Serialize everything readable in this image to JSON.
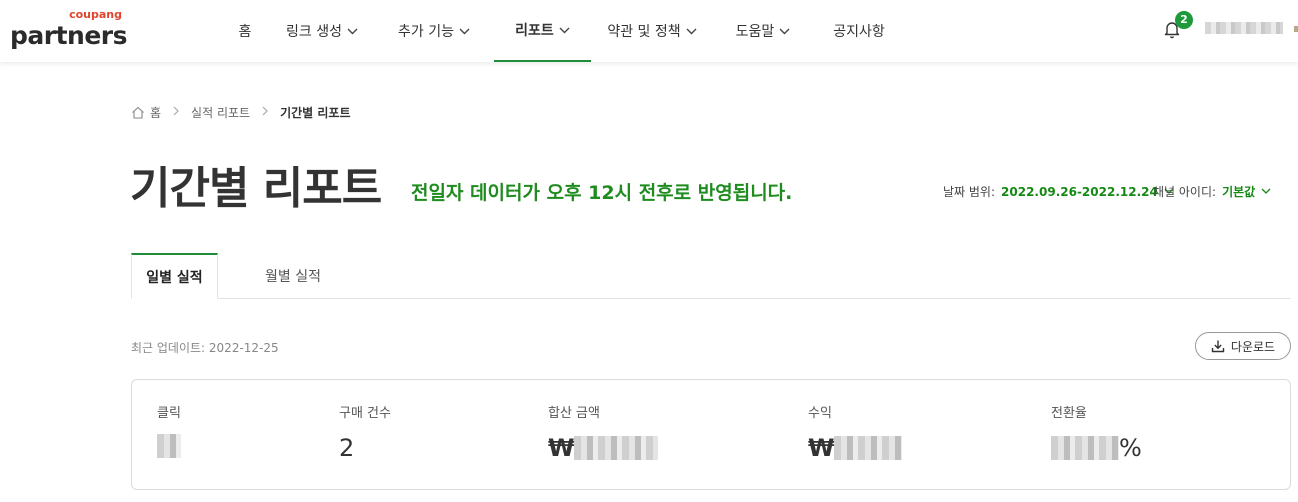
{
  "logo": {
    "sub": "coupang",
    "main": "partners"
  },
  "nav": {
    "items": [
      {
        "label": "홈",
        "has_dropdown": false
      },
      {
        "label": "링크 생성",
        "has_dropdown": true
      },
      {
        "label": "추가 기능",
        "has_dropdown": true
      },
      {
        "label": "리포트",
        "has_dropdown": true,
        "active": true
      },
      {
        "label": "약관 및 정책",
        "has_dropdown": true
      },
      {
        "label": "도움말",
        "has_dropdown": true
      },
      {
        "label": "공지사항",
        "has_dropdown": false
      }
    ],
    "notifications_count": "2"
  },
  "breadcrumb": {
    "home": "홈",
    "level1": "실적 리포트",
    "current": "기간별 리포트"
  },
  "page": {
    "title": "기간별 리포트",
    "notice": "전일자 데이터가 오후 12시 전후로 반영됩니다."
  },
  "filters": {
    "date_label": "날짜 범위:",
    "date_value": "2022.09.26-2022.12.24",
    "channel_label": "채널 아이디:",
    "channel_value": "기본값"
  },
  "tabs": [
    {
      "label": "일별 실적",
      "active": true
    },
    {
      "label": "월별 실적",
      "active": false
    }
  ],
  "last_updated": "최근 업데이트: 2022-12-25",
  "download_label": "다운로드",
  "stats": {
    "click": {
      "label": "클릭"
    },
    "purchases": {
      "label": "구매 건수",
      "value": "2"
    },
    "total_amount": {
      "label": "합산 금액",
      "currency": "₩"
    },
    "revenue": {
      "label": "수익",
      "currency": "₩"
    },
    "conversion": {
      "label": "전환율",
      "unit": "%"
    }
  },
  "colors": {
    "accent_green": "#1f8c3b",
    "notice_green": "#1f8c1f",
    "logo_red": "#e0442b"
  }
}
